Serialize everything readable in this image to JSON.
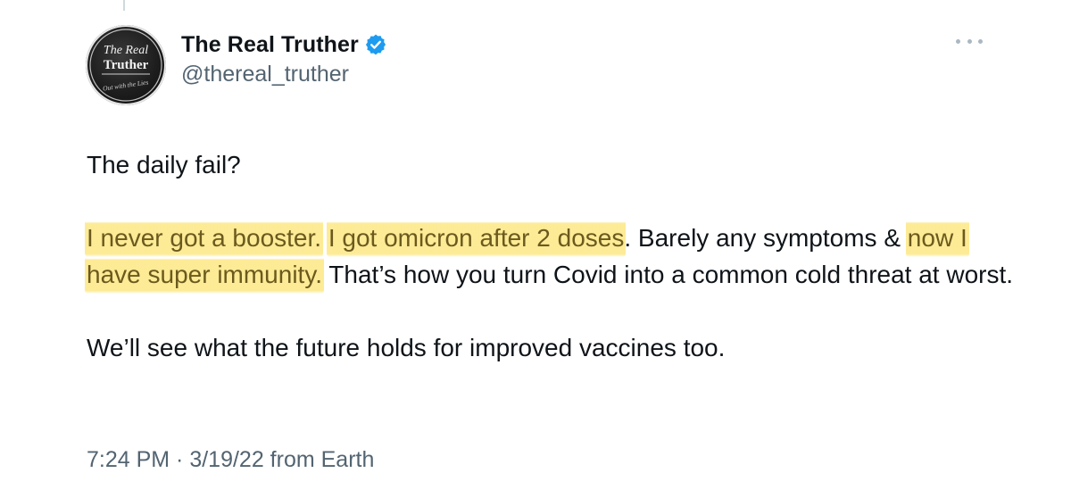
{
  "author": {
    "display_name": "The Real Truther",
    "handle": "@thereal_truther",
    "verified": true,
    "verified_color": "#1d9bf0",
    "avatar_logo_lines": [
      "The Real",
      "Truther"
    ],
    "avatar_tagline": "Out with the Lies"
  },
  "tweet": {
    "line1": "The daily fail?",
    "para2": {
      "hl1": "I never got a booster.",
      "sp1": " ",
      "hl2": "I got omicron after 2 doses",
      "t1": ". Barely any symptoms & ",
      "hl3": "now I have super immunity.",
      "t2": " That’s how you turn Covid into a common cold threat at worst."
    },
    "line3": "We’ll see what the future holds for improved vaccines too."
  },
  "meta": {
    "timestamp": "7:24 PM · 3/19/22 from Earth"
  },
  "colors": {
    "highlight": "#fde578",
    "secondary_text": "#536471"
  },
  "icons": {
    "more": "more-horizontal-icon",
    "verified": "verified-badge-icon"
  }
}
